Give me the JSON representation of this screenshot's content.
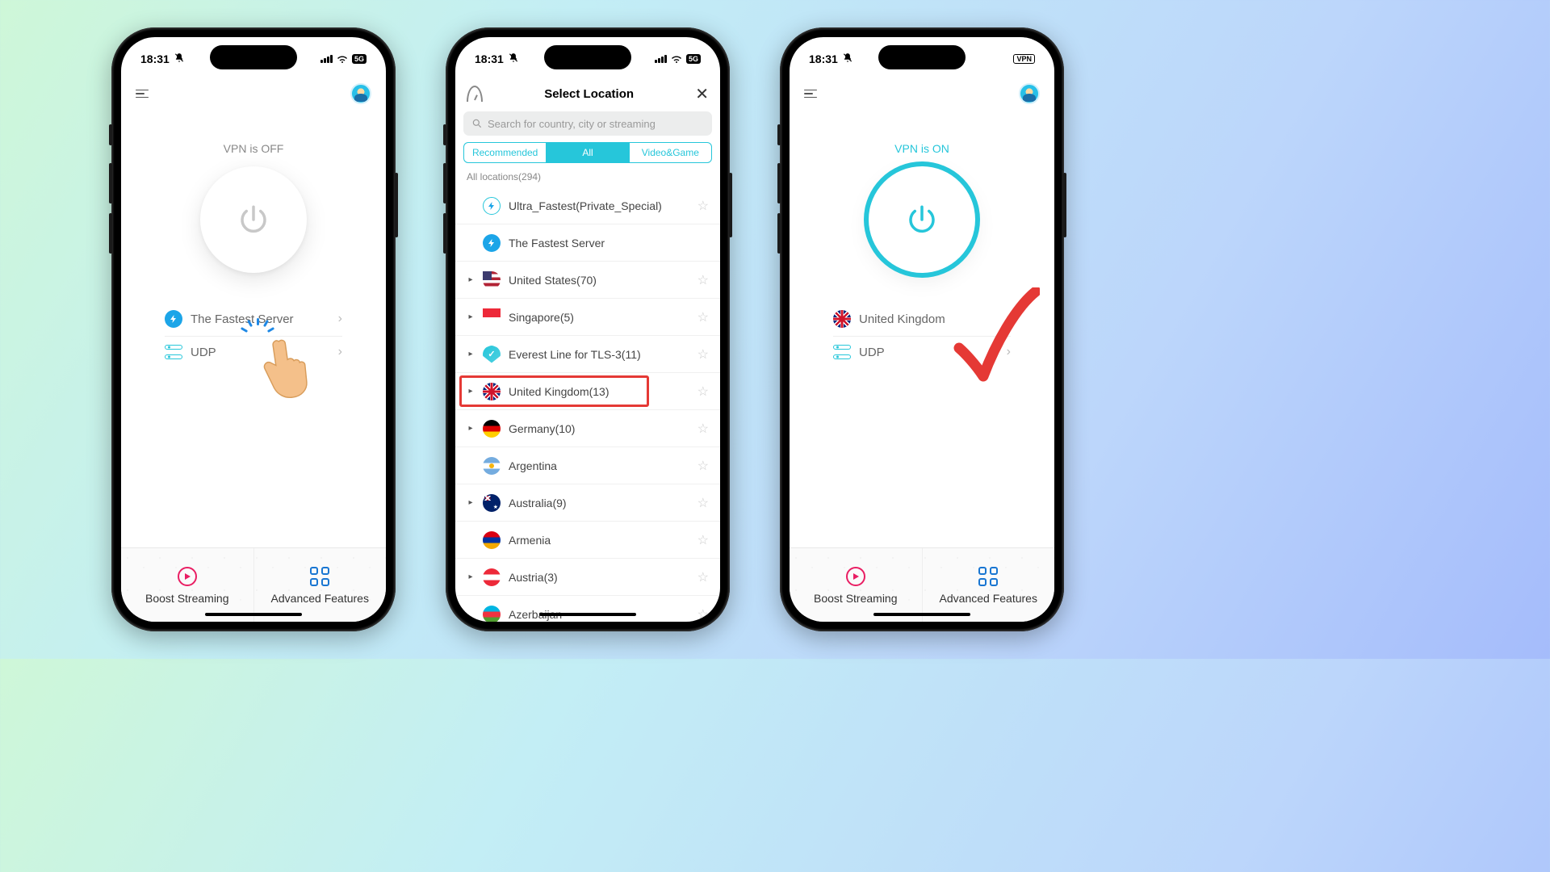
{
  "status": {
    "time": "18:31"
  },
  "phone1": {
    "vpn_status": "VPN is OFF",
    "server_label": "The Fastest Server",
    "protocol": "UDP",
    "bottom": {
      "boost": "Boost Streaming",
      "adv": "Advanced Features"
    }
  },
  "phone2": {
    "title": "Select Location",
    "search_placeholder": "Search for country, city or streaming",
    "tabs": {
      "rec": "Recommended",
      "all": "All",
      "vg": "Video&Game"
    },
    "section_label": "All locations(294)",
    "items": [
      {
        "name": "Ultra_Fastest(Private_Special)",
        "flag": "sp",
        "star": true,
        "exp": false
      },
      {
        "name": "The Fastest Server",
        "flag": "bolt",
        "star": false,
        "exp": false
      },
      {
        "name": "United States(70)",
        "flag": "us",
        "star": true,
        "exp": true
      },
      {
        "name": "Singapore(5)",
        "flag": "sg",
        "star": true,
        "exp": true
      },
      {
        "name": "Everest Line for TLS-3(11)",
        "flag": "shield",
        "star": true,
        "exp": true
      },
      {
        "name": "United Kingdom(13)",
        "flag": "uk",
        "star": true,
        "exp": true,
        "hl": true
      },
      {
        "name": "Germany(10)",
        "flag": "de",
        "star": true,
        "exp": true
      },
      {
        "name": "Argentina",
        "flag": "ar",
        "star": true,
        "exp": false
      },
      {
        "name": "Australia(9)",
        "flag": "au",
        "star": true,
        "exp": true
      },
      {
        "name": "Armenia",
        "flag": "am",
        "star": true,
        "exp": false
      },
      {
        "name": "Austria(3)",
        "flag": "at",
        "star": true,
        "exp": true
      },
      {
        "name": "Azerbaijan",
        "flag": "az",
        "star": true,
        "exp": false
      }
    ]
  },
  "phone3": {
    "vpn_status": "VPN is ON",
    "server_label": "United Kingdom",
    "protocol": "UDP",
    "bottom": {
      "boost": "Boost Streaming",
      "adv": "Advanced Features"
    }
  }
}
